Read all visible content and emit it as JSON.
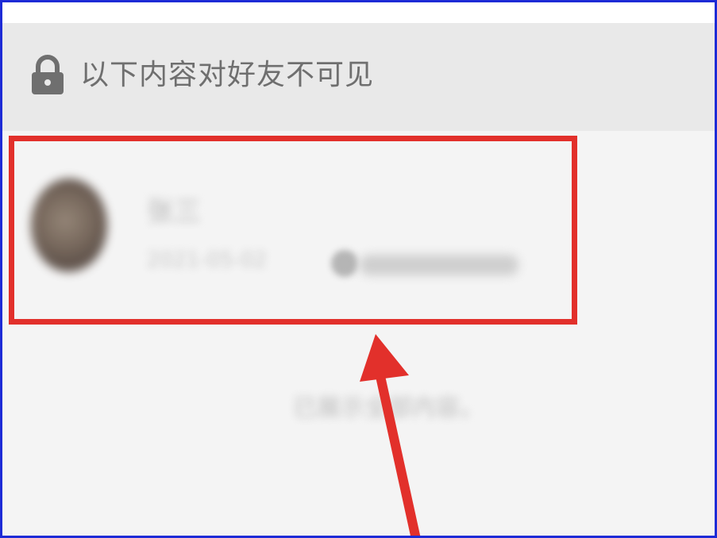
{
  "privacy_banner": {
    "icon": "lock-icon",
    "text": "以下内容对好友不可见"
  },
  "post": {
    "author_name": "张三",
    "meta_text": "2021-05-02",
    "blurred": true
  },
  "footer_hint": {
    "text": "已展示全部内容。",
    "blurred": true
  },
  "annotation": {
    "highlight_color": "#e2302b",
    "arrow_color": "#e2302b",
    "frame_color": "#1d2bd6"
  }
}
